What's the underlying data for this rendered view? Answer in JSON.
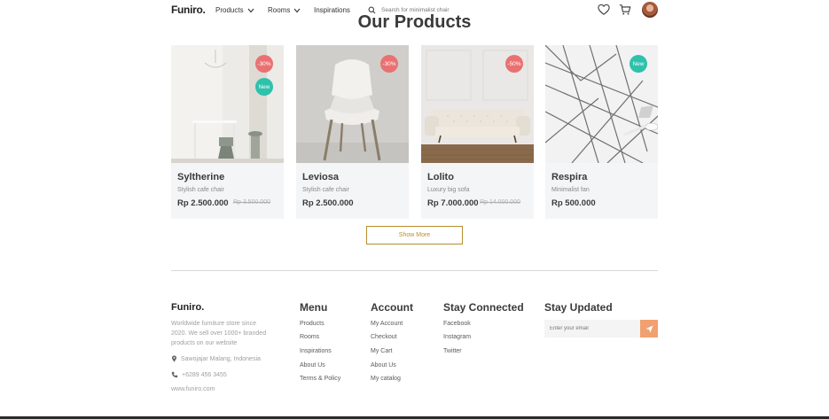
{
  "header": {
    "logo": "Funiro.",
    "nav": [
      "Products",
      "Rooms",
      "Inspirations"
    ],
    "search_placeholder": "Search for minimalist chair"
  },
  "section": {
    "title": "Our Products"
  },
  "products": [
    {
      "name": "Syltherine",
      "desc": "Stylish cafe chair",
      "price": "Rp 2.500.000",
      "old_price": "Rp 3.500.000",
      "badges": [
        "-30%",
        "New"
      ]
    },
    {
      "name": "Leviosa",
      "desc": "Stylish cafe chair",
      "price": "Rp 2.500.000",
      "old_price": "",
      "badges": [
        "-30%"
      ]
    },
    {
      "name": "Lolito",
      "desc": "Luxury big sofa",
      "price": "Rp 7.000.000",
      "old_price": "Rp 14.000.000",
      "badges": [
        "-50%"
      ]
    },
    {
      "name": "Respira",
      "desc": "Minimalist fan",
      "price": "Rp 500.000",
      "old_price": "",
      "badges": [
        "New"
      ]
    }
  ],
  "show_more": "Show More",
  "footer": {
    "logo": "Funiro.",
    "about": "Worldwide furniture store since 2020. We sell over 1000+ branded products on our website",
    "address": "Sawojajar Malang, Indonesia",
    "phone": "+6289 456 3455",
    "website": "www.funiro.com",
    "menu": {
      "title": "Menu",
      "links": [
        "Products",
        "Rooms",
        "Inspirations",
        "About Us",
        "Terms & Policy"
      ]
    },
    "account": {
      "title": "Account",
      "links": [
        "My Account",
        "Checkout",
        "My Cart",
        "About Us",
        "My catalog"
      ]
    },
    "social": {
      "title": "Stay Connected",
      "links": [
        "Facebook",
        "Instagram",
        "Twitter"
      ]
    },
    "newsletter": {
      "title": "Stay Updated",
      "placeholder": "Enter your email"
    }
  },
  "colors": {
    "accent": "#B88E2F",
    "sale": "#E97171",
    "new": "#2EC1AC",
    "send": "#F2A070"
  }
}
